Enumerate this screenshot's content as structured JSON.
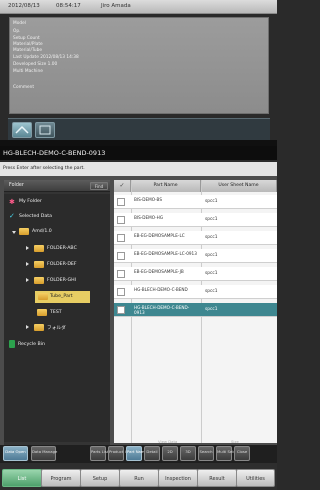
{
  "status_bar": {
    "date": "2012/08/13",
    "time": "08:54:17",
    "user": "Jiro Amada"
  },
  "info_panel": {
    "rows": [
      "Model",
      "Op.",
      "Setup Count",
      "Material/Plate",
      "Material/Tube",
      "Last Update   2012/08/13   14:38",
      "Developed Size  1.00",
      "Multi Machine",
      "Comment"
    ]
  },
  "program": {
    "name": "HG-BLECH-DEMO-C-BEND-0913"
  },
  "hint": {
    "text": "Press Enter after selecting the part."
  },
  "folder_panel": {
    "header": "Folder",
    "button": "Find"
  },
  "tree": {
    "items": [
      "My Folder",
      "Selected Data",
      "Amd/1.0",
      "FOLDER-ABC",
      "FOLDER-DEF",
      "FOLDER-GHI",
      "Tube_Part",
      "TEST",
      "フォルダ",
      "Recycle Bin"
    ]
  },
  "table": {
    "columns": [
      "Part Name",
      "User Sheet Name"
    ],
    "rows": [
      {
        "part": "BIS-DEMO-BS",
        "sheet": "spcc1"
      },
      {
        "part": "BIS-DEMO-HG",
        "sheet": "spcc1"
      },
      {
        "part": "EB-EG-DEMOSAMPLE-LC",
        "sheet": "spcc1"
      },
      {
        "part": "EB-EG-DEMOSAMPLE-LC-0913",
        "sheet": "spcc1"
      },
      {
        "part": "EB-EG-DEMOSAMPLE-JB",
        "sheet": "spcc1"
      },
      {
        "part": "HG-BLECH-DEMO-C-BEND",
        "sheet": "spcc1"
      },
      {
        "part": "HG-BLECH-DEMO-C-BEND-0913",
        "sheet": "spcc1"
      }
    ]
  },
  "toolbar": {
    "section_view": "View Data",
    "section_size": "Size",
    "buttons": [
      "Data Open",
      "Data Manage",
      "Parts List",
      "Product ID",
      "Part Name",
      "Detail",
      "2D",
      "3D",
      "Search",
      "Multi Select",
      "Close"
    ]
  },
  "bottom_bar": {
    "buttons": [
      "List",
      "Program",
      "Setup",
      "Run",
      "Inspection",
      "Result",
      "Utilities"
    ]
  }
}
